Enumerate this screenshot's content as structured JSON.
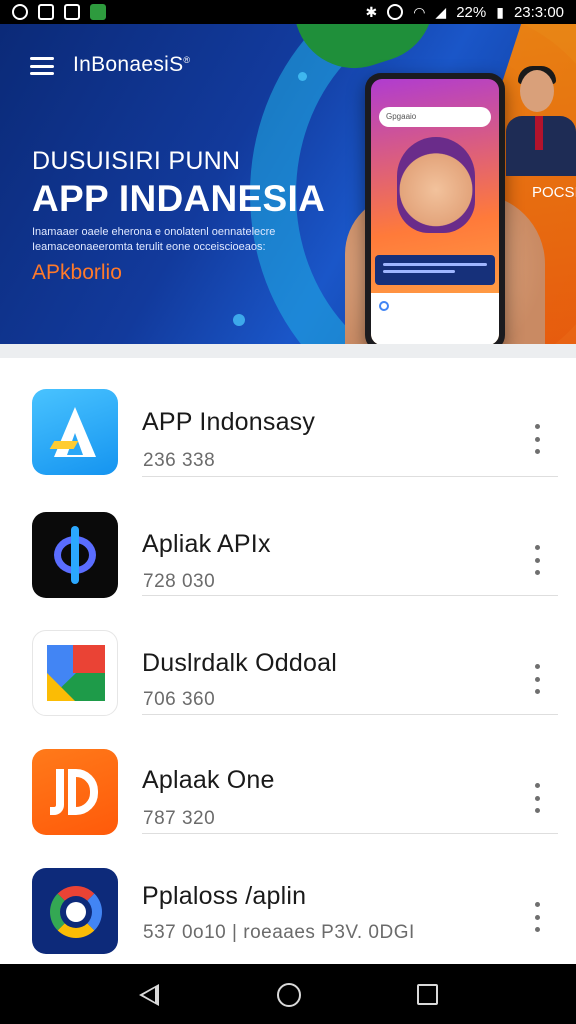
{
  "status_bar": {
    "left_icons": [
      "notification-icon",
      "image-icon",
      "gallery-icon",
      "app-icon"
    ],
    "right_icons": [
      "bluetooth-icon",
      "alarm-icon",
      "wifi-icon",
      "signal-icon",
      "battery-icon"
    ],
    "battery": "22%",
    "time": "23:3:00"
  },
  "banner": {
    "brand": "InBonaesiS",
    "brand_mark": "®",
    "subtitle": "DUSUISIRI PUNN",
    "title": "APP INDANESIA",
    "description": "Inamaaer oaele eherona e onolatenl oennatelecre Ieamaceonaeeromta terulit eone occeiscioeaos:",
    "cta": "APkborlio",
    "side_text": "POCSIC",
    "search_placeholder": "Gpgaaio",
    "colors": {
      "background": "#123a9c",
      "accent_orange": "#ff7a2a",
      "swoosh": "#21b0e6"
    }
  },
  "apps": [
    {
      "name": "APP Indonsasy",
      "meta": "236 338",
      "icon": "a-letter-app-icon"
    },
    {
      "name": "Apliak APIx",
      "meta": "728 030",
      "icon": "stylus-ring-app-icon"
    },
    {
      "name": "Duslrdalk Oddoal",
      "meta": "706 360",
      "icon": "color-blocks-app-icon"
    },
    {
      "name": "Aplaak One",
      "meta": "787 320",
      "icon": "jp-letter-app-icon"
    },
    {
      "name": "Pplaloss /aplin",
      "meta": "537 0o10 | roeaaes P3V. 0DGI",
      "icon": "color-ring-app-icon"
    }
  ],
  "nav": {
    "back": "back-icon",
    "home": "home-icon",
    "recents": "recents-icon"
  }
}
